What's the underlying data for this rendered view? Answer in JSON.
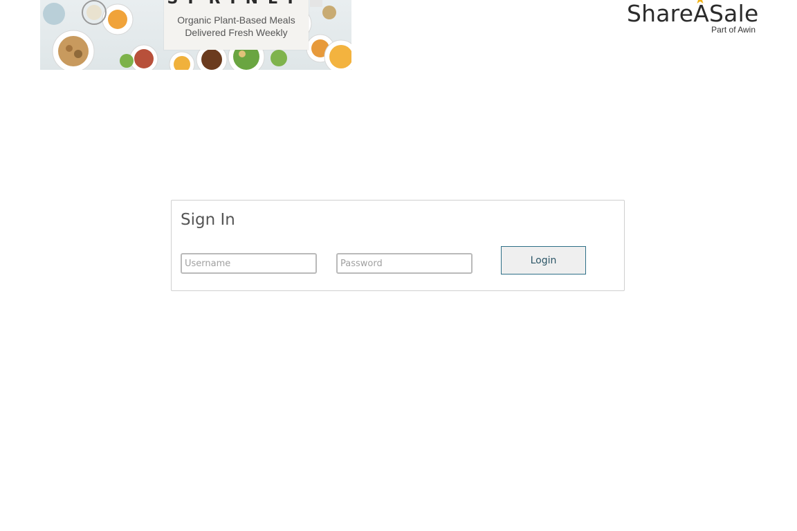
{
  "banner": {
    "brand": "SPRINLY",
    "line1": "Organic Plant-Based Meals",
    "line2": "Delivered Fresh Weekly"
  },
  "logo": {
    "name": "ShareASale",
    "subtitle": "Part of Awin",
    "star_color": "#f2b51c",
    "icon": "star-icon"
  },
  "signin": {
    "title": "Sign In",
    "username_placeholder": "Username",
    "password_placeholder": "Password",
    "login_label": "Login",
    "accent": "#2d6e86"
  }
}
